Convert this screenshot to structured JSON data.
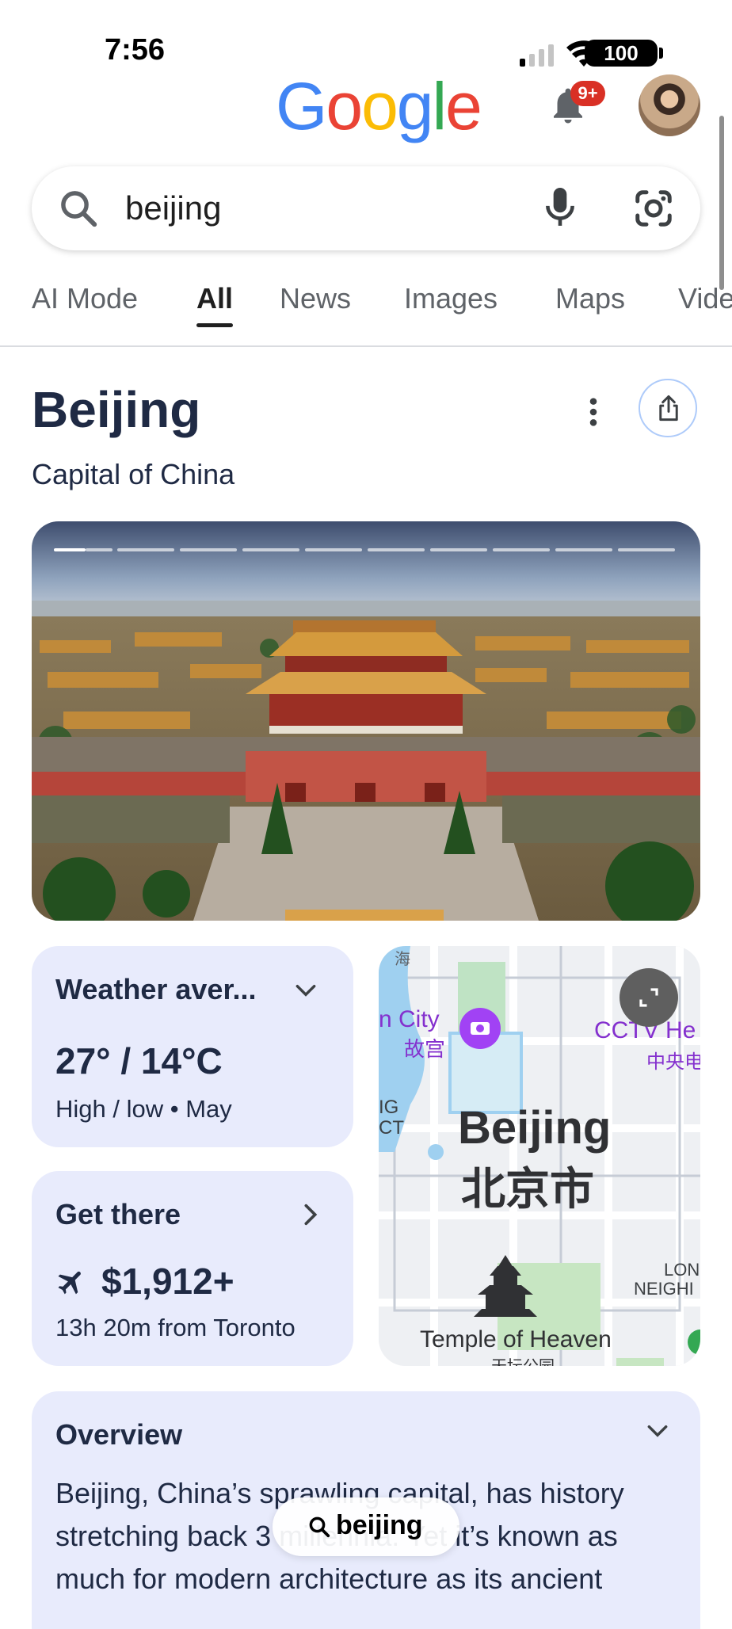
{
  "status_bar": {
    "time": "7:56",
    "battery": "100"
  },
  "header": {
    "logo_letters": [
      {
        "ch": "G",
        "color": "#4285F4"
      },
      {
        "ch": "o",
        "color": "#EA4335"
      },
      {
        "ch": "o",
        "color": "#FBBC05"
      },
      {
        "ch": "g",
        "color": "#4285F4"
      },
      {
        "ch": "l",
        "color": "#34A853"
      },
      {
        "ch": "e",
        "color": "#EA4335"
      }
    ],
    "notification_badge": "9+"
  },
  "search": {
    "query": "beijing"
  },
  "tabs": [
    {
      "label": "AI Mode"
    },
    {
      "label": "All"
    },
    {
      "label": "News"
    },
    {
      "label": "Images"
    },
    {
      "label": "Maps"
    },
    {
      "label": "Vide"
    }
  ],
  "entity": {
    "title": "Beijing",
    "subtitle": "Capital of China"
  },
  "weather_card": {
    "title": "Weather aver...",
    "temps": "27° / 14°C",
    "detail": "High / low • May"
  },
  "get_there_card": {
    "title": "Get there",
    "price": "$1,912+",
    "detail": "13h 20m from Toronto"
  },
  "map": {
    "city_name": "Beijing",
    "city_name_cn": "北京市",
    "label_forbidden_city": "n City",
    "label_forbidden_city_cn": "故宫",
    "label_cctv": "CCTV He",
    "label_cctv_cn": "中央电",
    "label_temple": "Temple of Heaven",
    "label_temple_cn": "天坛公园",
    "label_district": "IG",
    "label_district2": "CT",
    "label_lon": "LON",
    "label_neigh": "NEIGHI",
    "label_top_cn": "海"
  },
  "overview": {
    "title": "Overview",
    "text": "Beijing, China’s sprawling capital, has history stretching back 3 millennia. Yet it’s known as much for modern architecture as its ancient"
  },
  "floating_search": {
    "label": "beijing"
  }
}
